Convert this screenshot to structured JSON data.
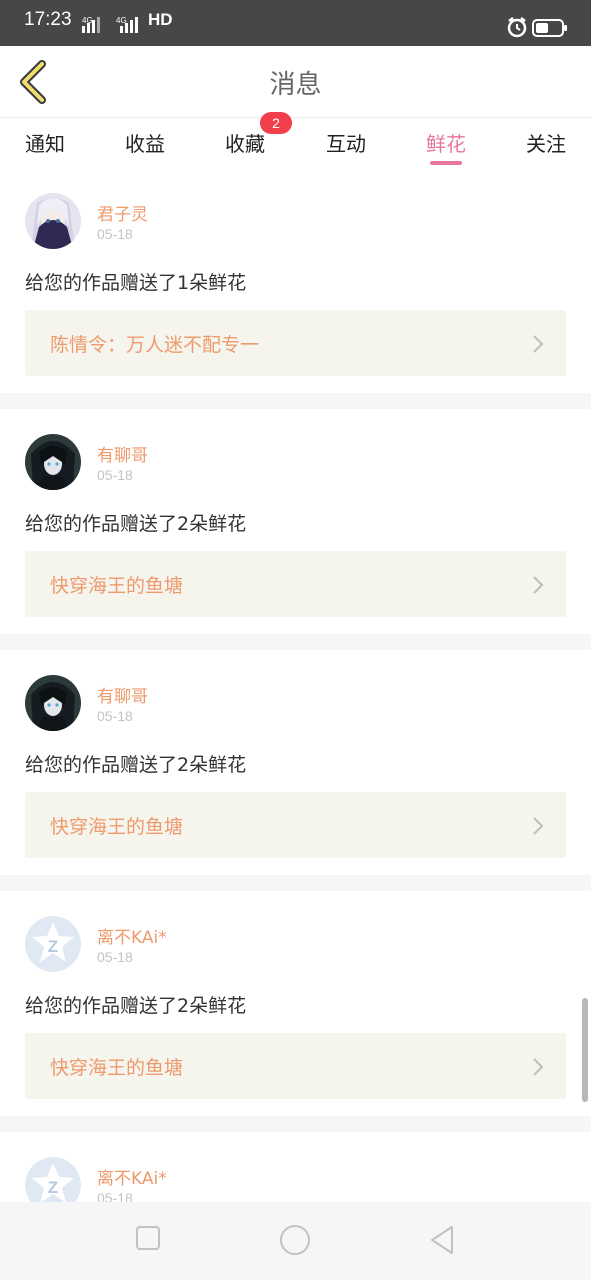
{
  "status_bar": {
    "time": "17:23",
    "network": "HD",
    "colors": {
      "bg": "#474747"
    }
  },
  "header": {
    "title": "消息",
    "back_icon": "chevron-left-icon"
  },
  "tabs": [
    {
      "label": "通知",
      "active": false
    },
    {
      "label": "收益",
      "active": false
    },
    {
      "label": "收藏",
      "active": false,
      "badge": "2"
    },
    {
      "label": "互动",
      "active": false
    },
    {
      "label": "鲜花",
      "active": true
    },
    {
      "label": "关注",
      "active": false
    }
  ],
  "notifications": [
    {
      "user": "君子灵",
      "date": "05-18",
      "message": "给您的作品赠送了1朵鲜花",
      "work": "陈情令：万人迷不配专一",
      "avatar": "anime-girl"
    },
    {
      "user": "有聊哥",
      "date": "05-18",
      "message": "给您的作品赠送了2朵鲜花",
      "work": "快穿海王的鱼塘",
      "avatar": "dark-anime"
    },
    {
      "user": "有聊哥",
      "date": "05-18",
      "message": "给您的作品赠送了2朵鲜花",
      "work": "快穿海王的鱼塘",
      "avatar": "dark-anime"
    },
    {
      "user": "离不KAi*",
      "date": "05-18",
      "message": "给您的作品赠送了2朵鲜花",
      "work": "快穿海王的鱼塘",
      "avatar": "default"
    },
    {
      "user": "离不KAi*",
      "date": "05-18"
    }
  ],
  "colors": {
    "accent": "#e8779f",
    "username": "#ee9a6d",
    "badge": "#f1404b",
    "link_bg": "#f5f5ee"
  }
}
